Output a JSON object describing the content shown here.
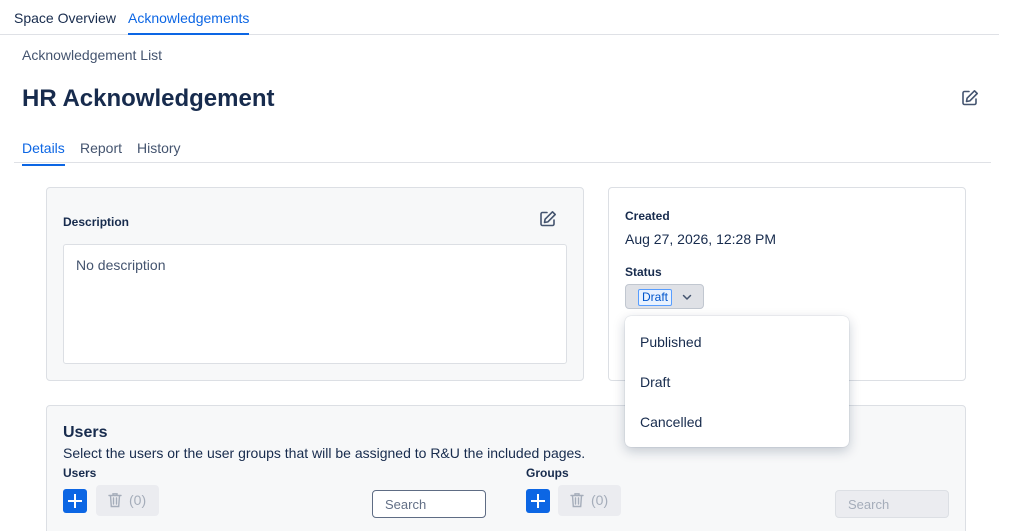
{
  "top_tabs": [
    {
      "label": "Space Overview"
    },
    {
      "label": "Acknowledgements"
    }
  ],
  "breadcrumb": "Acknowledgement List",
  "page_title": "HR Acknowledgement",
  "sub_tabs": [
    {
      "label": "Details"
    },
    {
      "label": "Report"
    },
    {
      "label": "History"
    }
  ],
  "description": {
    "label": "Description",
    "value": "No description"
  },
  "info": {
    "created_label": "Created",
    "created_value": "Aug 27, 2026, 12:28 PM",
    "status_label": "Status",
    "status_value": "Draft"
  },
  "status_options": [
    "Published",
    "Draft",
    "Cancelled"
  ],
  "users_section": {
    "title": "Users",
    "subtitle": "Select the users or the user groups that will be assigned to R&U the included pages.",
    "users_label": "Users",
    "groups_label": "Groups",
    "users_count": "(0)",
    "groups_count": "(0)",
    "search_placeholder": "Search"
  },
  "icons": {
    "title_edit": "edit-icon",
    "description_edit": "edit-icon",
    "status_chevron": "chevron-down-icon",
    "add": "plus-icon",
    "delete": "trash-icon"
  },
  "colors": {
    "accent": "#0c66e4",
    "text": "#172b4d",
    "lozenge_bg": "#e9f2ff",
    "lozenge_border": "#579dff",
    "card_bg": "#f7f8f9"
  }
}
